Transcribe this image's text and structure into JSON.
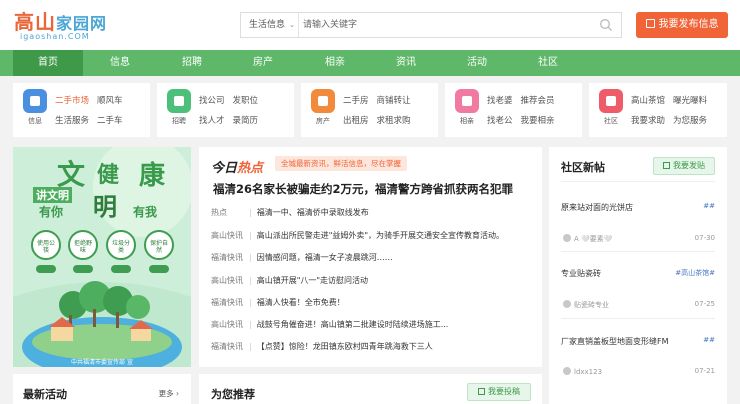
{
  "header": {
    "logo_text_a": "高山",
    "logo_text_b": "家园网",
    "logo_sub": "igaoshan.COM",
    "search_category": "生活信息",
    "search_placeholder": "请输入关键字",
    "publish_label": "我要发布信息"
  },
  "nav": [
    "首页",
    "信息",
    "招聘",
    "房产",
    "相亲",
    "资讯",
    "活动",
    "社区"
  ],
  "categories": [
    {
      "icon": "info-icon",
      "label": "信息",
      "color": "#4a8fe0",
      "links": [
        [
          "二手市场",
          "顺风车"
        ],
        [
          "生活服务",
          "二手车"
        ]
      ]
    },
    {
      "icon": "briefcase-icon",
      "label": "招聘",
      "color": "#4cc07a",
      "links": [
        [
          "找公司",
          "发职位"
        ],
        [
          "找人才",
          "录简历"
        ]
      ]
    },
    {
      "icon": "building-icon",
      "label": "房产",
      "color": "#f28a3b",
      "links": [
        [
          "二手房",
          "商铺转让"
        ],
        [
          "出租房",
          "求租求购"
        ]
      ]
    },
    {
      "icon": "heart-icon",
      "label": "相亲",
      "color": "#f07aa0",
      "links": [
        [
          "找老婆",
          "推荐会员"
        ],
        [
          "找老公",
          "我要相亲"
        ]
      ]
    },
    {
      "icon": "community-icon",
      "label": "社区",
      "color": "#ee5c6a",
      "links": [
        [
          "高山茶馆",
          "曝光曝料"
        ],
        [
          "我要求助",
          "为您服务"
        ]
      ]
    }
  ],
  "banner": {
    "big1": "文",
    "big2": "健",
    "big3": "康",
    "mid": "明",
    "left_small": "讲文明",
    "row2a": "有你",
    "row2b": "有我",
    "circles": [
      "使用公筷",
      "拒绝野味",
      "垃圾分类",
      "保护自然"
    ],
    "footer": "中共福清市委宣传部 宣"
  },
  "hot": {
    "title_a": "今日",
    "title_b": "热点",
    "tag": "全城最新资讯，鲜活信息，尽在掌握",
    "headline": "福清26名家长被骗走约2万元，福清警方跨省抓获两名犯罪",
    "rows": [
      {
        "k": "热点",
        "t": "福清一中、福清侨中录取线发布"
      },
      {
        "k": "高山快讯",
        "t": "高山派出所民警走进\"益姆外卖\"，为骑手开展交通安全宣传教育活动。"
      },
      {
        "k": "福清快讯",
        "t": "因情感问题，福清一女子凌晨跳河……"
      },
      {
        "k": "高山快讯",
        "t": "高山镇开展\"八一\"走访慰问活动"
      },
      {
        "k": "福清快讯",
        "t": "福清人快看！全市免费！"
      },
      {
        "k": "高山快讯",
        "t": "战鼓号角催奋进！高山镇第二批建设时陆续进场施工..."
      },
      {
        "k": "福清快讯",
        "t": "【点赞】惊险！龙田镇东欧村四青年跳海救下三人"
      }
    ]
  },
  "community": {
    "title": "社区新帖",
    "post_button": "我要发贴",
    "posts": [
      {
        "title": "原来站对面的光饼店",
        "tag": "##",
        "user": "A 🤍要素🤍",
        "date": "07-30"
      },
      {
        "title": "专业贴瓷砖",
        "tag": "#高山茶馆#",
        "user": "贴瓷砖专业",
        "date": "07-25"
      },
      {
        "title": "厂家直销盖板型地面变形缝FM",
        "tag": "##",
        "user": "ldxx123",
        "date": "07-21"
      }
    ]
  },
  "latest": {
    "title": "最新活动",
    "more": "更多 ›"
  },
  "recommend": {
    "title": "为您推荐",
    "button": "我要投稿"
  }
}
